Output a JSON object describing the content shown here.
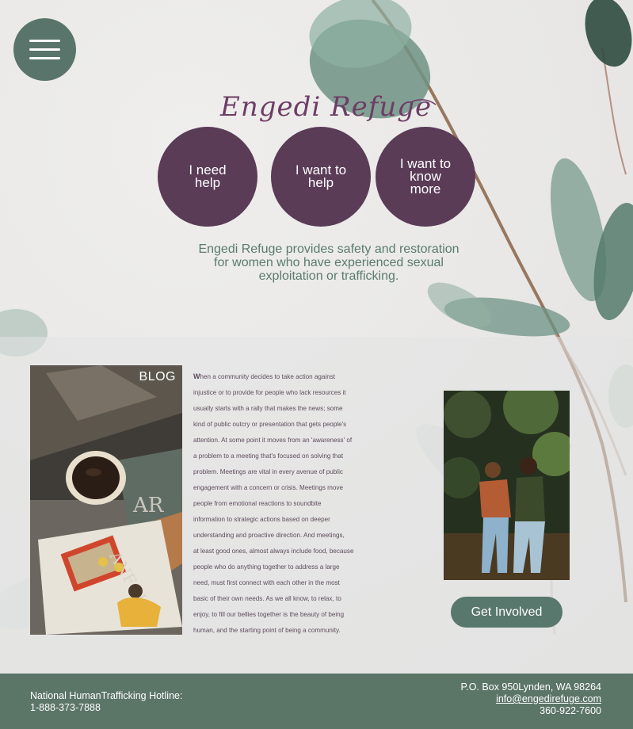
{
  "brand": {
    "logo_text": "Engedi Refuge"
  },
  "menu": {
    "icon": "hamburger-menu-icon"
  },
  "cta_buttons": [
    {
      "label_line1": "I need",
      "label_line2": "help",
      "label_line3": ""
    },
    {
      "label_line1": "I want to",
      "label_line2": "help",
      "label_line3": ""
    },
    {
      "label_line1": "I want to",
      "label_line2": "know",
      "label_line3": "more"
    }
  ],
  "mission": {
    "line1": "Engedi Refuge provides safety and restoration",
    "line2": "for women who have experienced sexual",
    "line3": "exploitation or trafficking."
  },
  "blog": {
    "label": "BLOG",
    "first_letter": "W",
    "lines": [
      "hen a community decides to take action against",
      "injustice or to provide for people who lack resources it",
      "usually starts with a rally that makes the news; some",
      "kind of public outcry or presentation that gets people's",
      "attention.  At some point it moves from an 'awareness' of",
      "a problem to a meeting that's focused on solving that",
      "problem.  Meetings are vital in every avenue of public",
      "engagement with a concern or crisis.  Meetings move",
      "people from emotional reactions to soundbite",
      "information to strategic actions based on deeper",
      "understanding and proactive direction.  And meetings,",
      "at least good ones, almost always include food, because",
      "people who do anything together to address a large",
      "need, must first connect with each other in the most",
      "basic of their own needs.  As we all know, to relax, to",
      "enjoy, to fill our bellies together is the beauty of being",
      "human, and the starting point of being a community."
    ]
  },
  "involve": {
    "button_label": "Get Involved"
  },
  "footer": {
    "hotline_label": "National HumanTrafficking Hotline:",
    "hotline_number": "1-888-373-7888",
    "address": "P.O. Box 950Lynden, WA 98264",
    "email": "info@engedirefuge.com",
    "phone": "360-922-7600"
  },
  "colors": {
    "plum": "#5a3c57",
    "sage": "#59756b",
    "footer": "#5b7567",
    "logo": "#6d3d66",
    "mission_text": "#5b7b70"
  }
}
